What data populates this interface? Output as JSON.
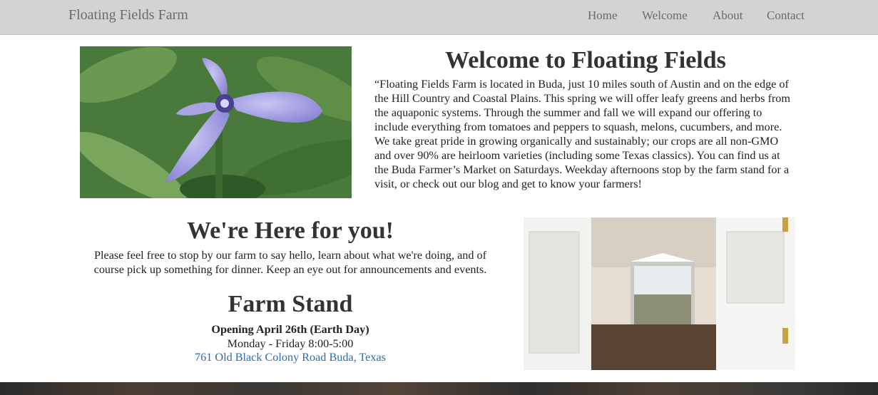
{
  "navbar": {
    "brand": "Floating Fields Farm",
    "items": [
      {
        "label": "Home"
      },
      {
        "label": "Welcome"
      },
      {
        "label": "About"
      },
      {
        "label": "Contact"
      }
    ]
  },
  "welcome": {
    "title": "Welcome to Floating Fields",
    "body": "“Floating Fields Farm is located in Buda, just 10 miles south of Austin and on the edge of the Hill Country and Coastal Plains. This spring we will offer leafy greens and herbs from the aquaponic systems. Through the summer and fall we will expand our offering to include everything from tomatoes and peppers to squash, melons, cucumbers, and more. We take great pride in growing organically and sustainably; our crops are all non-GMO and over 90% are heirloom varieties (including some Texas classics). You can find us at the Buda Farmer’s Market on Saturdays. Weekday afternoons stop by the farm stand for a visit, or check out our blog and get to know your farmers!"
  },
  "here": {
    "title": "We're Here for you!",
    "body": "Please feel free to stop by our farm to say hello, learn about what we're doing, and of course pick up something for dinner. Keep an eye out for announcements and events."
  },
  "farm_stand": {
    "title": "Farm Stand",
    "opening": "Opening April 26th (Earth Day)",
    "hours": "Monday - Friday 8:00-5:00",
    "address": "761 Old Black Colony Road Buda, Texas"
  },
  "colors": {
    "navbar_bg": "#d3d3d3",
    "nav_text": "#6b6b6b",
    "heading": "#333333",
    "link": "#2d6aa8"
  }
}
